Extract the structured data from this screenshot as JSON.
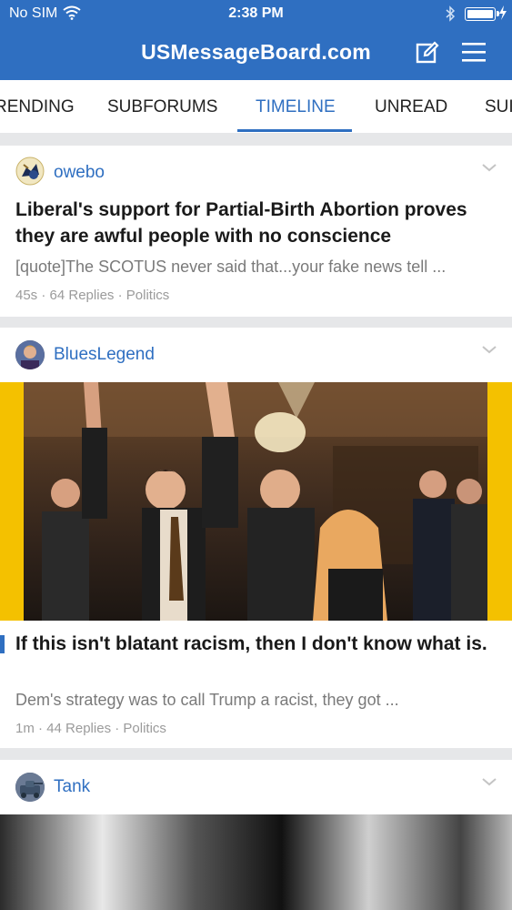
{
  "status": {
    "carrier": "No SIM",
    "time": "2:38 PM"
  },
  "header": {
    "site_title": "USMessageBoard.com"
  },
  "tabs": [
    {
      "label": "RENDING",
      "active": false
    },
    {
      "label": "SUBFORUMS",
      "active": false
    },
    {
      "label": "TIMELINE",
      "active": true
    },
    {
      "label": "UNREAD",
      "active": false
    },
    {
      "label": "SUI",
      "active": false
    }
  ],
  "posts": [
    {
      "username": "owebo",
      "title": "Liberal's support for Partial-Birth Abortion proves they are awful people with no conscience",
      "excerpt": "[quote]The SCOTUS never said that...your fake news tell ...",
      "time": "45s",
      "replies": "64 Replies",
      "forum": "Politics",
      "unread": false
    },
    {
      "username": "BluesLegend",
      "title": "If this isn't blatant racism, then I don't know what is.",
      "excerpt": "Dem's strategy was to call Trump a racist, they got ...",
      "time": "1m",
      "replies": "44 Replies",
      "forum": "Politics",
      "unread": true
    },
    {
      "username": "Tank"
    }
  ],
  "colors": {
    "accent": "#2f6fc1",
    "photo_border": "#f4c100",
    "separator": "#e6e7e9"
  },
  "icons": [
    "wifi-icon",
    "bluetooth-icon",
    "battery-icon",
    "compose-icon",
    "menu-icon",
    "chevron-down-icon"
  ]
}
